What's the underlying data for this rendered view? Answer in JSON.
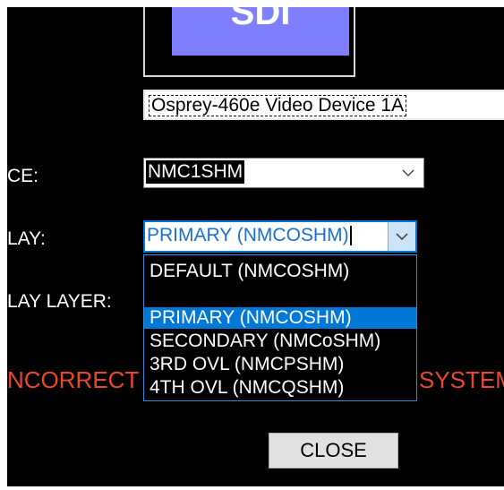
{
  "preview": {
    "label": "SDI"
  },
  "device": {
    "name": "Osprey-460e Video Device 1A"
  },
  "labels": {
    "source": "CE:",
    "overlay": "LAY:",
    "overlay_layer": "LAY LAYER:"
  },
  "source_combo": {
    "value": "NMC1SHM"
  },
  "overlay_combo": {
    "value": "PRIMARY (NMCOSHM)",
    "options": [
      "DEFAULT (NMCOSHM)",
      "",
      "PRIMARY (NMCOSHM)",
      "SECONDARY (NMCoSHM)",
      "3RD OVL (NMCPSHM)",
      "4TH OVL (NMCQSHM)"
    ],
    "selected_index": 2
  },
  "warning": {
    "left": "NCORRECT",
    "right": "SYSTEM"
  },
  "actions": {
    "close": "CLOSE"
  },
  "colors": {
    "accent": "#0078d7",
    "warning": "#e8482b",
    "preview_bg": "#7f7fff"
  }
}
